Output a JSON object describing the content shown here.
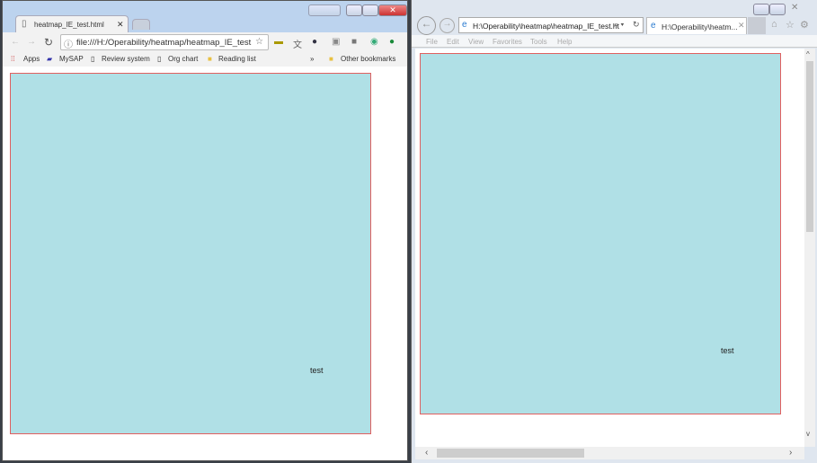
{
  "chrome": {
    "tab_title": "heatmap_IE_test.html",
    "url": "file:///H:/Operability/heatmap/heatmap_IE_test",
    "bookmarks": [
      "Apps",
      "MySAP",
      "Review system",
      "Org chart",
      "Reading list"
    ],
    "overflow": "»",
    "other_bookmarks": "Other bookmarks",
    "heatmap_label": "test"
  },
  "ie": {
    "address": "H:\\Operability\\heatmap\\heatmap_IE_test.ht",
    "tab_title": "H:\\Operability\\heatm...",
    "menu": [
      "File",
      "Edit",
      "View",
      "Favorites",
      "Tools",
      "Help"
    ],
    "heatmap_label": "test"
  },
  "colors": {
    "heatmap_fill": "#b0e0e6",
    "heatmap_border": "#e06060"
  }
}
